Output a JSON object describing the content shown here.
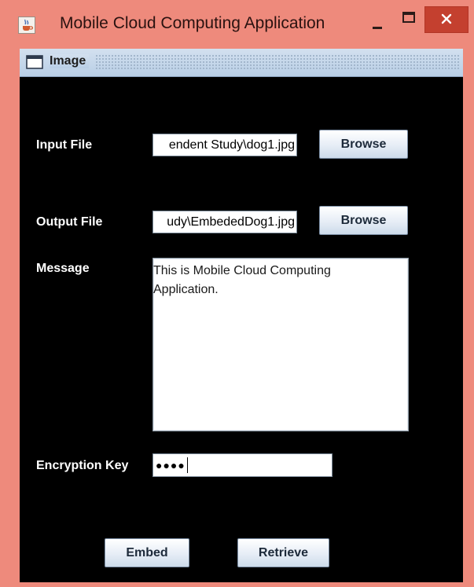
{
  "window": {
    "title": "Mobile Cloud Computing Application",
    "icons": {
      "app": "java-cup-icon",
      "minimize": "minimize-icon",
      "maximize": "maximize-icon",
      "close": "close-icon"
    }
  },
  "internal_frame": {
    "title": "Image",
    "icon": "frame-window-icon"
  },
  "form": {
    "input_file": {
      "label": "Input File",
      "value": "endent Study\\dog1.jpg",
      "button_label": "Browse"
    },
    "output_file": {
      "label": "Output File",
      "value": "udy\\EmbededDog1.jpg",
      "button_label": "Browse"
    },
    "message": {
      "label": "Message",
      "value": "This is Mobile Cloud Computing\nApplication."
    },
    "encryption_key": {
      "label": "Encryption Key",
      "value": "●●●●"
    }
  },
  "actions": {
    "embed_label": "Embed",
    "retrieve_label": "Retrieve"
  }
}
